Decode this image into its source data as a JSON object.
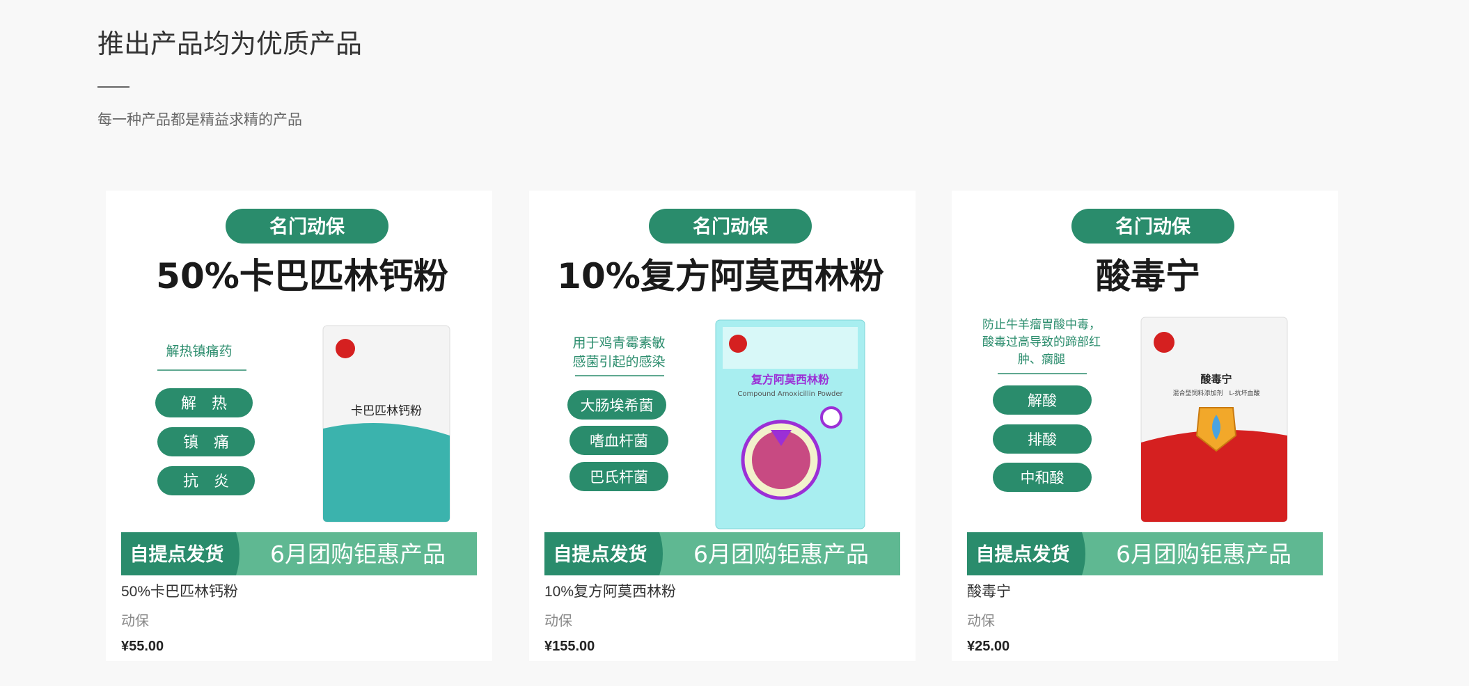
{
  "section": {
    "title": "推出产品均为优质产品",
    "subtitle": "每一种产品都是精益求精的产品"
  },
  "colors": {
    "brand_green": "#2a8c6c",
    "banner_green": "#5fb892",
    "teal": "#3bb3ad",
    "cyan_bag": "#a8eef0",
    "red_bag": "#d52020"
  },
  "products": [
    {
      "name": "50%卡巴匹林钙粉",
      "category": "动保",
      "price": "¥55.00",
      "image": {
        "badge": "名门动保",
        "headline": "50%卡巴匹林钙粉",
        "tagline": "解热镇痛药",
        "pills": [
          "解　热",
          "镇　痛",
          "抗　炎"
        ],
        "bag_label": "卡巴匹林钙粉",
        "banner_left": "自提点发货",
        "banner_right": "6月团购钜惠产品"
      }
    },
    {
      "name": "10%复方阿莫西林粉",
      "category": "动保",
      "price": "¥155.00",
      "image": {
        "badge": "名门动保",
        "headline": "10%复方阿莫西林粉",
        "tagline_lines": [
          "用于鸡青霉素敏",
          "感菌引起的感染"
        ],
        "pills": [
          "大肠埃希菌",
          "嗜血杆菌",
          "巴氏杆菌"
        ],
        "bag_label": "复方阿莫西林粉",
        "bag_sublabel": "Compound Amoxicillin Powder",
        "banner_left": "自提点发货",
        "banner_right": "6月团购钜惠产品"
      }
    },
    {
      "name": "酸毒宁",
      "category": "动保",
      "price": "¥25.00",
      "image": {
        "badge": "名门动保",
        "headline": "酸毒宁",
        "tagline_lines": [
          "防止牛羊瘤胃酸中毒，",
          "酸毒过高导致的蹄部红",
          "肿、瘸腿"
        ],
        "pills": [
          "解酸",
          "排酸",
          "中和酸"
        ],
        "bag_label": "酸毒宁",
        "bag_sublabel": "混合型饲料添加剂　L-抗坏血酸",
        "banner_left": "自提点发货",
        "banner_right": "6月团购钜惠产品"
      }
    }
  ]
}
